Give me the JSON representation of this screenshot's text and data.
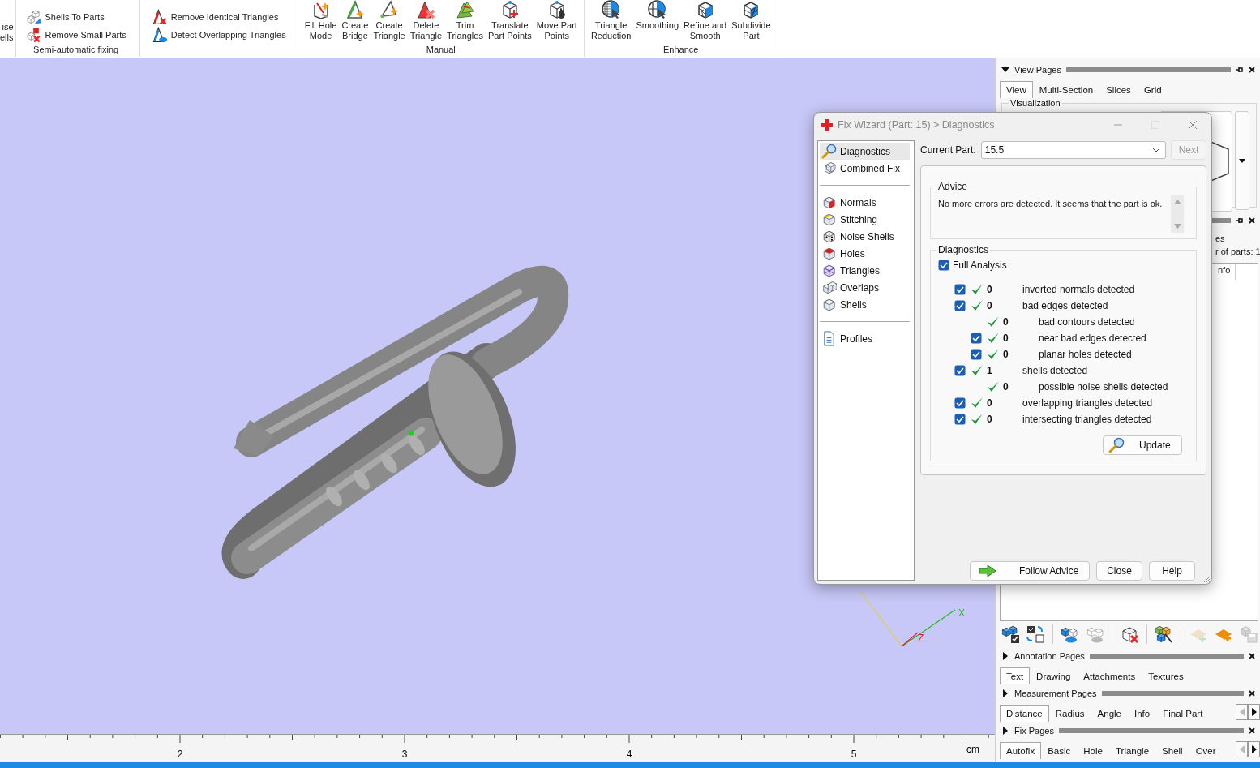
{
  "ribbon": {
    "groups": [
      {
        "kind": "cut",
        "lines": [
          "ise",
          "ells"
        ]
      },
      {
        "kind": "small",
        "label": "Semi-automatic fixing",
        "items": [
          "Shells To Parts",
          "Remove Small Parts"
        ]
      },
      {
        "kind": "small",
        "items": [
          "Remove Identical Triangles",
          "Detect Overlapping Triangles"
        ]
      },
      {
        "kind": "large",
        "label": "Manual",
        "items": [
          [
            "Fill Hole",
            "Mode"
          ],
          [
            "Create",
            "Bridge"
          ],
          [
            "Create",
            "Triangle"
          ],
          [
            "Delete",
            "Triangle"
          ],
          [
            "Trim",
            "Triangles"
          ],
          [
            "Translate",
            "Part Points"
          ],
          [
            "Move Part",
            "Points"
          ]
        ]
      },
      {
        "kind": "large",
        "label": "Enhance",
        "items": [
          [
            "Triangle",
            "Reduction"
          ],
          [
            "Smoothing"
          ],
          [
            "Refine and",
            "Smooth"
          ],
          [
            "Subdivide",
            "Part"
          ]
        ]
      }
    ]
  },
  "viewport": {
    "axis_labels": [
      {
        "label": "X",
        "color": "#22bb22"
      },
      {
        "label": "Z",
        "color": "#e02020"
      }
    ],
    "ruler": {
      "labels": [
        "2",
        "3",
        "4",
        "5"
      ],
      "unit": "cm"
    }
  },
  "right_panel": {
    "view_pages": {
      "title": "View Pages",
      "expanded": true,
      "pin": true,
      "tabs": [
        {
          "label": "View",
          "selected": true
        },
        {
          "label": "Multi-Section",
          "selected": false
        },
        {
          "label": "Slices",
          "selected": false
        },
        {
          "label": "Grid",
          "selected": false
        }
      ],
      "group_title": "Visualization"
    },
    "parts_panel": {
      "pin": true,
      "lines": [
        "es",
        "r of parts: 1"
      ],
      "column": "nfo"
    },
    "pages": [
      {
        "title": "Annotation Pages",
        "expanded": false,
        "tabs": [
          {
            "label": "Text",
            "selected": true
          },
          {
            "label": "Drawing",
            "selected": false
          },
          {
            "label": "Attachments",
            "selected": false
          },
          {
            "label": "Textures",
            "selected": false
          }
        ]
      },
      {
        "title": "Measurement Pages",
        "expanded": false,
        "scroll_arrows": true,
        "tabs": [
          {
            "label": "Distance",
            "selected": true
          },
          {
            "label": "Radius",
            "selected": false
          },
          {
            "label": "Angle",
            "selected": false
          },
          {
            "label": "Info",
            "selected": false
          },
          {
            "label": "Final Part",
            "selected": false
          }
        ]
      },
      {
        "title": "Fix Pages",
        "expanded": false,
        "scroll_arrows": true,
        "tabs": [
          {
            "label": "Autofix",
            "selected": true
          },
          {
            "label": "Basic",
            "selected": false
          },
          {
            "label": "Hole",
            "selected": false
          },
          {
            "label": "Triangle",
            "selected": false
          },
          {
            "label": "Shell",
            "selected": false
          },
          {
            "label": "Over",
            "selected": false
          }
        ]
      }
    ]
  },
  "fix_wizard": {
    "title": "Fix Wizard (Part: 15) > Diagnostics",
    "nav_groups": [
      {
        "items": [
          {
            "label": "Diagnostics",
            "selected": true
          },
          {
            "label": "Combined Fix",
            "selected": false
          }
        ]
      },
      {
        "items": [
          {
            "label": "Normals",
            "selected": false
          },
          {
            "label": "Stitching",
            "selected": false
          },
          {
            "label": "Noise Shells",
            "selected": false
          },
          {
            "label": "Holes",
            "selected": false
          },
          {
            "label": "Triangles",
            "selected": false
          },
          {
            "label": "Overlaps",
            "selected": false
          },
          {
            "label": "Shells",
            "selected": false
          }
        ]
      },
      {
        "items": [
          {
            "label": "Profiles",
            "selected": false
          }
        ]
      }
    ],
    "current_part": {
      "label": "Current Part:",
      "value": "15.5"
    },
    "next_button": {
      "label": "Next",
      "disabled": true
    },
    "advice": {
      "title": "Advice",
      "text": "No more errors are detected. It seems that the part is ok."
    },
    "diagnostics": {
      "title": "Diagnostics",
      "full_analysis": {
        "label": "Full Analysis",
        "checked": true
      },
      "rows": [
        {
          "kind": "checkbox",
          "checked": true,
          "ok": true,
          "count": "0",
          "label": "inverted normals detected"
        },
        {
          "kind": "checkbox",
          "checked": true,
          "ok": true,
          "count": "0",
          "label": "bad edges detected",
          "children": [
            {
              "kind": "plain",
              "ok": true,
              "count": "0",
              "label": "bad contours detected"
            },
            {
              "kind": "checkbox",
              "checked": true,
              "ok": true,
              "count": "0",
              "label": "near bad edges detected"
            },
            {
              "kind": "checkbox",
              "checked": true,
              "ok": true,
              "count": "0",
              "label": "planar holes detected"
            }
          ]
        },
        {
          "kind": "checkbox",
          "checked": true,
          "ok": true,
          "count": "1",
          "label": "shells detected",
          "children": [
            {
              "kind": "plain",
              "ok": true,
              "count": "0",
              "label": "possible noise shells detected"
            }
          ]
        },
        {
          "kind": "checkbox",
          "checked": true,
          "ok": true,
          "count": "0",
          "label": "overlapping triangles detected"
        },
        {
          "kind": "checkbox",
          "checked": true,
          "ok": true,
          "count": "0",
          "label": "intersecting triangles detected"
        }
      ],
      "update_button": "Update"
    },
    "buttons": [
      {
        "kind": "arrow",
        "label": "Follow Advice"
      },
      {
        "kind": "plain",
        "label": "Close"
      },
      {
        "kind": "plain",
        "label": "Help"
      }
    ]
  }
}
